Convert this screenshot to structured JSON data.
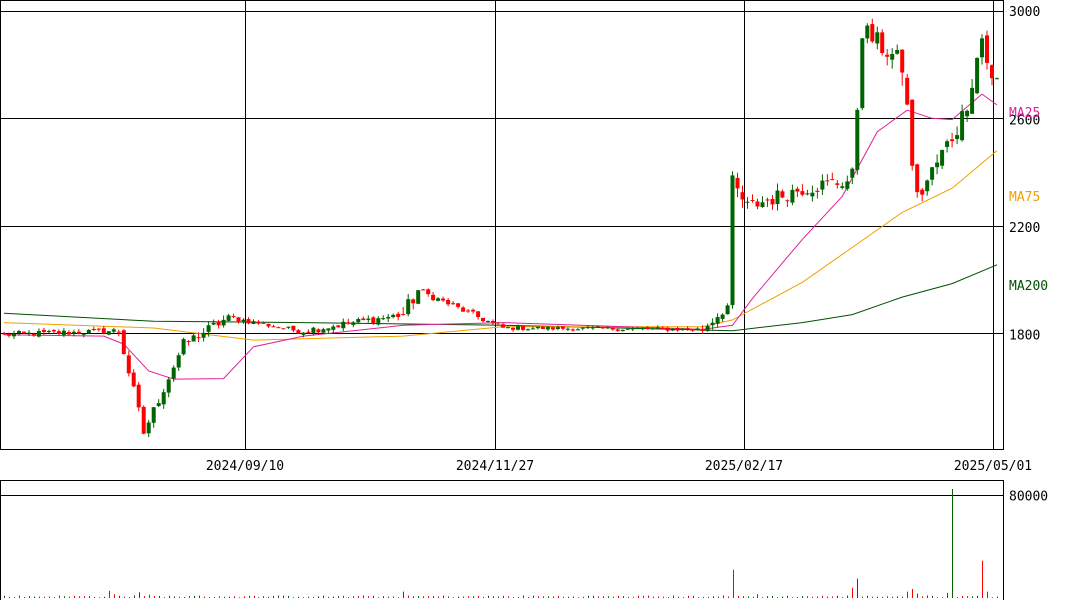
{
  "chart_data": {
    "type": "candlestick",
    "price_axis": {
      "ticks": [
        "3000",
        "2600",
        "2200",
        "1800"
      ],
      "tick_values": [
        3000,
        2600,
        2200,
        1800
      ],
      "range": [
        1370,
        3040
      ],
      "grid": true
    },
    "date_axis": {
      "labels": [
        "2024/09/10",
        "2024/11/27",
        "2025/02/17",
        "2025/05/01"
      ]
    },
    "volume_axis": {
      "ticks": [
        "80000"
      ],
      "tick_values": [
        80000
      ],
      "range": [
        0,
        92000
      ]
    },
    "colors": {
      "up": "#006400",
      "down": "#ff0000",
      "ma25": "#e0209a",
      "ma75": "#f0a000",
      "ma200": "#005000",
      "grid": "#000000"
    },
    "legend": {
      "ma25": "MA25",
      "ma75": "MA75",
      "ma200": "MA200"
    },
    "segments": [
      {
        "from": 0,
        "to": 23,
        "start": 1795,
        "end": 1810,
        "amp": 12
      },
      {
        "from": 23,
        "to": 28,
        "start": 1810,
        "end": 1430,
        "amp": 25
      },
      {
        "from": 28,
        "to": 36,
        "start": 1430,
        "end": 1760,
        "amp": 20
      },
      {
        "from": 36,
        "to": 45,
        "start": 1760,
        "end": 1860,
        "amp": 20
      },
      {
        "from": 45,
        "to": 60,
        "start": 1860,
        "end": 1805,
        "amp": 10
      },
      {
        "from": 60,
        "to": 80,
        "start": 1810,
        "end": 1870,
        "amp": 15
      },
      {
        "from": 80,
        "to": 83,
        "start": 1870,
        "end": 1960,
        "amp": 30
      },
      {
        "from": 83,
        "to": 100,
        "start": 1960,
        "end": 1820,
        "amp": 12
      },
      {
        "from": 100,
        "to": 140,
        "start": 1820,
        "end": 1815,
        "amp": 8
      },
      {
        "from": 140,
        "to": 146,
        "start": 1815,
        "end": 1920,
        "amp": 20
      },
      {
        "from": 146,
        "to": 149,
        "start": 2350,
        "end": 2270,
        "amp": 40
      },
      {
        "from": 149,
        "to": 160,
        "start": 2270,
        "end": 2340,
        "amp": 30
      },
      {
        "from": 160,
        "to": 170,
        "start": 2340,
        "end": 2370,
        "amp": 30
      },
      {
        "from": 170,
        "to": 172,
        "start": 2370,
        "end": 2930,
        "amp": 50
      },
      {
        "from": 172,
        "to": 180,
        "start": 2930,
        "end": 2800,
        "amp": 40
      },
      {
        "from": 180,
        "to": 183,
        "start": 2800,
        "end": 2270,
        "amp": 60
      },
      {
        "from": 183,
        "to": 192,
        "start": 2300,
        "end": 2600,
        "amp": 40
      },
      {
        "from": 192,
        "to": 196,
        "start": 2600,
        "end": 2900,
        "amp": 50
      },
      {
        "from": 196,
        "to": 199,
        "start": 2900,
        "end": 2650,
        "amp": 40
      }
    ],
    "ma25_points": [
      [
        0,
        1795
      ],
      [
        20,
        1790
      ],
      [
        24,
        1760
      ],
      [
        29,
        1660
      ],
      [
        34,
        1630
      ],
      [
        44,
        1632
      ],
      [
        50,
        1750
      ],
      [
        60,
        1790
      ],
      [
        80,
        1830
      ],
      [
        100,
        1840
      ],
      [
        140,
        1815
      ],
      [
        146,
        1830
      ],
      [
        150,
        1930
      ],
      [
        160,
        2150
      ],
      [
        168,
        2310
      ],
      [
        175,
        2550
      ],
      [
        181,
        2630
      ],
      [
        186,
        2600
      ],
      [
        190,
        2595
      ],
      [
        196,
        2690
      ],
      [
        199,
        2650
      ]
    ],
    "ma75_points": [
      [
        0,
        1840
      ],
      [
        30,
        1820
      ],
      [
        50,
        1775
      ],
      [
        80,
        1790
      ],
      [
        100,
        1825
      ],
      [
        140,
        1825
      ],
      [
        146,
        1850
      ],
      [
        160,
        1990
      ],
      [
        170,
        2120
      ],
      [
        180,
        2250
      ],
      [
        190,
        2340
      ],
      [
        199,
        2480
      ]
    ],
    "ma200_points": [
      [
        0,
        1875
      ],
      [
        30,
        1845
      ],
      [
        60,
        1840
      ],
      [
        100,
        1830
      ],
      [
        146,
        1810
      ],
      [
        160,
        1840
      ],
      [
        170,
        1870
      ],
      [
        180,
        1935
      ],
      [
        190,
        1985
      ],
      [
        199,
        2055
      ]
    ],
    "volume_spikes": [
      {
        "i": 21,
        "v": 5500,
        "up": false
      },
      {
        "i": 22,
        "v": 3000,
        "up": false
      },
      {
        "i": 27,
        "v": 4500,
        "up": true
      },
      {
        "i": 29,
        "v": 2500,
        "up": false
      },
      {
        "i": 80,
        "v": 5000,
        "up": true
      },
      {
        "i": 146,
        "v": 22000,
        "up": false
      },
      {
        "i": 151,
        "v": 3000,
        "up": false
      },
      {
        "i": 170,
        "v": 8000,
        "up": false
      },
      {
        "i": 171,
        "v": 15000,
        "up": true
      },
      {
        "i": 181,
        "v": 5000,
        "up": false
      },
      {
        "i": 182,
        "v": 7000,
        "up": false
      },
      {
        "i": 183,
        "v": 3500,
        "up": false
      },
      {
        "i": 189,
        "v": 4000,
        "up": true
      },
      {
        "i": 190,
        "v": 85000,
        "up": true
      },
      {
        "i": 196,
        "v": 29000,
        "up": false
      },
      {
        "i": 197,
        "v": 5000,
        "up": false
      }
    ]
  }
}
